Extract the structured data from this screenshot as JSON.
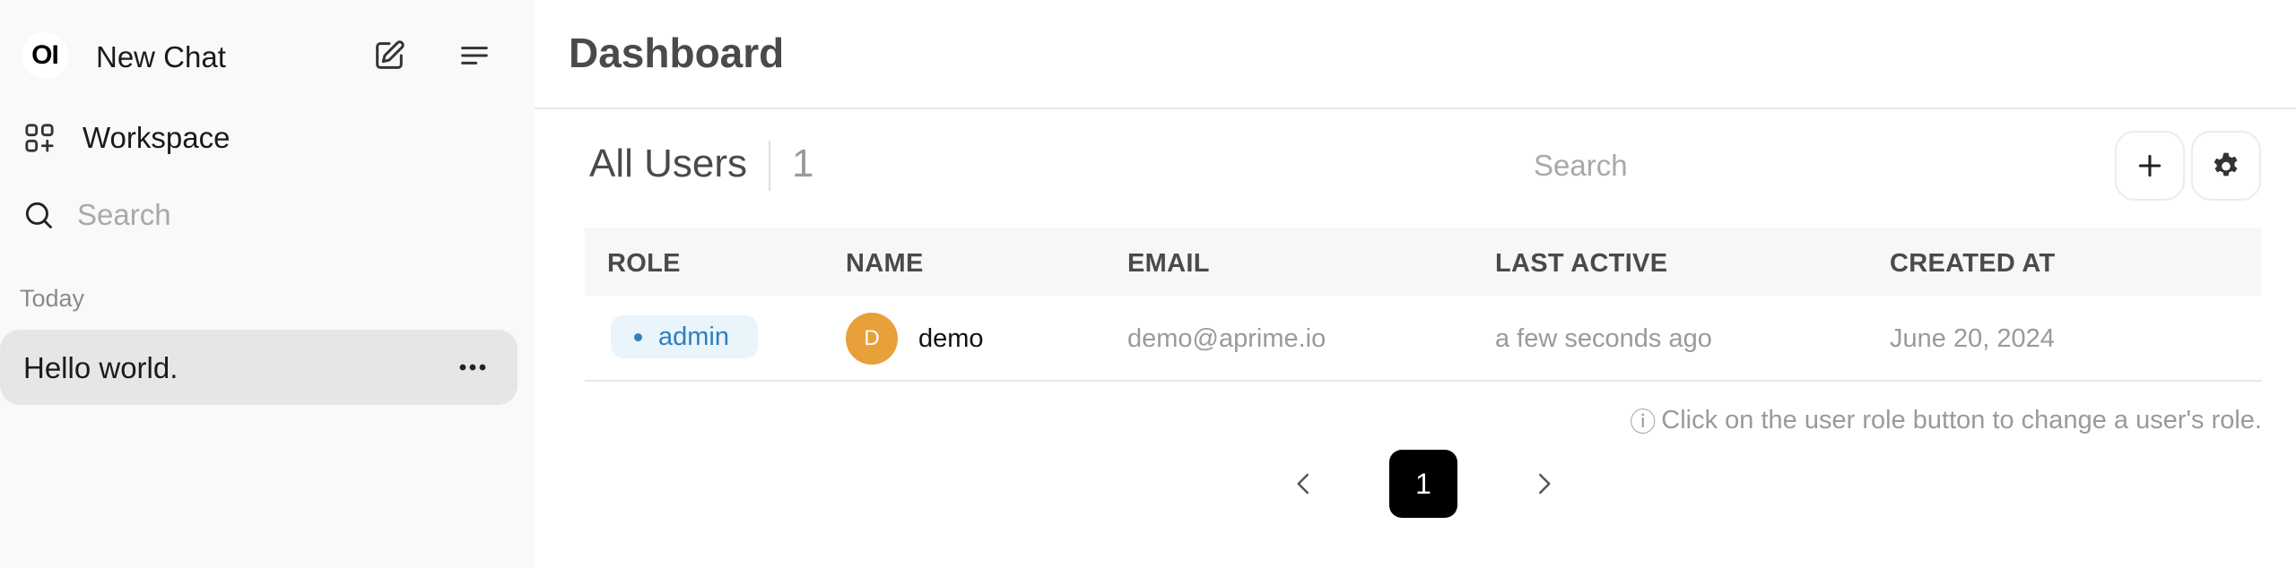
{
  "sidebar": {
    "logo_text": "OI",
    "new_chat_label": "New Chat",
    "workspace_label": "Workspace",
    "search_placeholder": "Search",
    "section_label": "Today",
    "chats": [
      {
        "title": "Hello world."
      }
    ],
    "icons": {
      "compose": "compose-icon",
      "menu": "menu-icon",
      "workspace": "grid-plus-icon",
      "search": "search-icon",
      "chat_more": "more-horizontal-icon"
    }
  },
  "main": {
    "title": "Dashboard",
    "users_heading": "All Users",
    "user_count": "1",
    "search_placeholder": "Search",
    "icons": {
      "add": "plus-icon",
      "settings": "gear-icon"
    },
    "table": {
      "columns": [
        "ROLE",
        "NAME",
        "EMAIL",
        "LAST ACTIVE",
        "CREATED AT"
      ],
      "rows": [
        {
          "role": "admin",
          "avatar_initial": "D",
          "name": "demo",
          "email": "demo@aprime.io",
          "last_active": "a few seconds ago",
          "created_at": "June 20, 2024"
        }
      ]
    },
    "hint_icon": "ⓘ",
    "hint_text": "Click on the user role button to change a user's role.",
    "pagination": {
      "current_page": "1"
    }
  },
  "colors": {
    "sidebar_bg": "#f9f9f9",
    "selected_chat_bg": "#e6e6e6",
    "role_badge_bg": "#e9f4fb",
    "role_badge_text": "#2f7fbf",
    "avatar_bg": "#e8a03a",
    "page_button_active": "#000000"
  }
}
